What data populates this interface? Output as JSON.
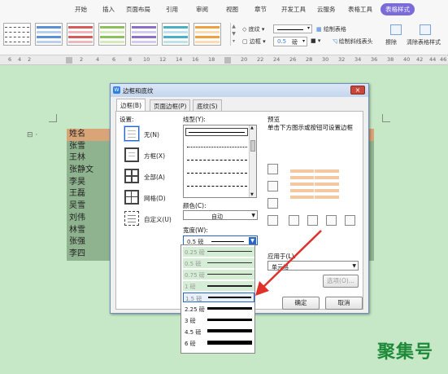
{
  "ribbon": {
    "tabs": [
      "开始",
      "插入",
      "页面布局",
      "引用",
      "审阅",
      "视图",
      "章节",
      "开发工具",
      "云服务",
      "表格工具",
      "表格样式"
    ],
    "active_tab": "表格样式",
    "shading_label": "底纹",
    "border_label": "边框",
    "line_weight": "0.5",
    "line_unit": "磅",
    "draw_table": "绘制表格",
    "draw_diagonal": "绘制斜线表头",
    "erase": "擦除",
    "clear_style": "清除表格样式"
  },
  "ruler": {
    "numbers": [
      "6",
      "4",
      "2",
      "2",
      "4",
      "6",
      "8",
      "10",
      "12",
      "14",
      "16",
      "18",
      "20",
      "22",
      "24",
      "26",
      "28",
      "30",
      "32",
      "34",
      "36",
      "38",
      "40",
      "42",
      "44",
      "46"
    ]
  },
  "document": {
    "names": [
      "姓名",
      "张雪",
      "王林",
      "张静文",
      "李昊",
      "王磊",
      "吴雪",
      "刘伟",
      "林雪",
      "张强",
      "李四"
    ],
    "watermark": "聚集号"
  },
  "dialog": {
    "title": "边框和底纹",
    "close": "×",
    "tabs": [
      "边框(B)",
      "页面边框(P)",
      "底纹(S)"
    ],
    "settings_label": "设置:",
    "settings": [
      "无(N)",
      "方框(X)",
      "全部(A)",
      "网格(D)",
      "自定义(U)"
    ],
    "style_label": "线型(Y):",
    "color_label": "颜色(C):",
    "color_value": "自动",
    "width_label": "宽度(W):",
    "width_value": "0.5  磅",
    "width_options": [
      "0.25 磅",
      "0.5 磅",
      "0.75 磅",
      "1 磅",
      "1.5 磅",
      "2.25 磅",
      "3 磅",
      "4.5 磅",
      "6 磅"
    ],
    "preview_label": "预览",
    "preview_hint": "单击下方图示或按钮可设置边框",
    "apply_to_label": "应用于(L):",
    "apply_to_value": "单元格",
    "options_button": "选项(O)...",
    "ok_button": "确定",
    "cancel_button": "取消"
  },
  "colors": {
    "doc_background": "#c6e8c6",
    "table_header": "#d9a477",
    "table_body": "#8fb38f",
    "watermark": "#1d8a3a",
    "arrow": "#e0302a",
    "tab_active": "#7a6bd9"
  }
}
